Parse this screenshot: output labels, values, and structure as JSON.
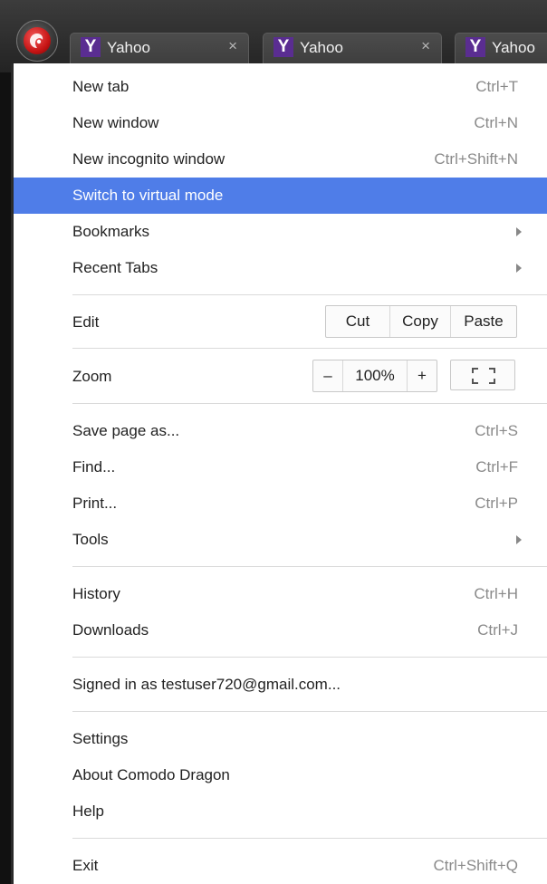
{
  "tabs": [
    {
      "label": "Yahoo",
      "icon": "yahoo-y-icon",
      "close": "×"
    },
    {
      "label": "Yahoo",
      "icon": "yahoo-y-icon",
      "close": "×"
    },
    {
      "label": "Yahoo",
      "icon": "yahoo-y-icon"
    }
  ],
  "tab_icon_glyph": "Y",
  "menu": {
    "new_tab": {
      "label": "New tab",
      "shortcut": "Ctrl+T"
    },
    "new_window": {
      "label": "New window",
      "shortcut": "Ctrl+N"
    },
    "new_incognito": {
      "label": "New incognito window",
      "shortcut": "Ctrl+Shift+N"
    },
    "virtual_mode": {
      "label": "Switch to virtual mode"
    },
    "bookmarks": {
      "label": "Bookmarks"
    },
    "recent_tabs": {
      "label": "Recent Tabs"
    },
    "edit": {
      "label": "Edit",
      "cut": "Cut",
      "copy": "Copy",
      "paste": "Paste"
    },
    "zoom": {
      "label": "Zoom",
      "minus": "–",
      "value": "100%",
      "plus": "+"
    },
    "save_page": {
      "label": "Save page as...",
      "shortcut": "Ctrl+S"
    },
    "find": {
      "label": "Find...",
      "shortcut": "Ctrl+F"
    },
    "print": {
      "label": "Print...",
      "shortcut": "Ctrl+P"
    },
    "tools": {
      "label": "Tools"
    },
    "history": {
      "label": "History",
      "shortcut": "Ctrl+H"
    },
    "downloads": {
      "label": "Downloads",
      "shortcut": "Ctrl+J"
    },
    "signed_in": {
      "label": "Signed in as testuser720@gmail.com..."
    },
    "settings": {
      "label": "Settings"
    },
    "about": {
      "label": "About Comodo Dragon"
    },
    "help": {
      "label": "Help"
    },
    "exit": {
      "label": "Exit",
      "shortcut": "Ctrl+Shift+Q"
    }
  },
  "colors": {
    "highlight": "#4f7de8",
    "yahoo_purple": "#5a2d91",
    "dragon_red": "#c71515"
  }
}
